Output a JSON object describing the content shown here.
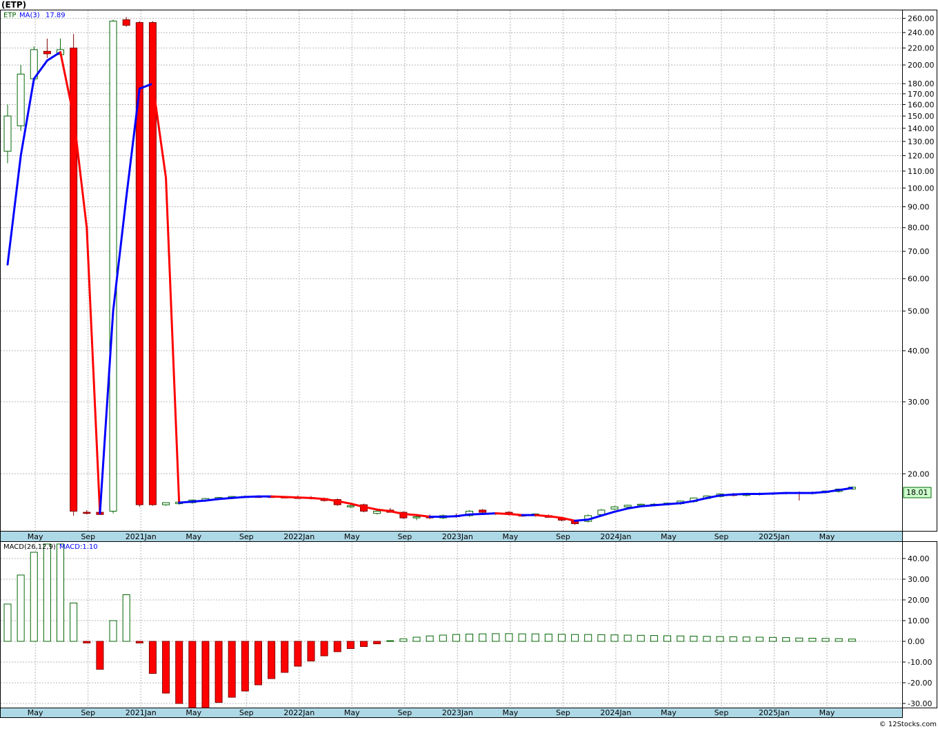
{
  "header": {
    "symbol_title": "(ETP)",
    "price_legend_symbol": "ETP",
    "price_legend_ma_label": "MA(3)",
    "price_legend_ma_value": "17.89",
    "macd_legend_label": "MACD(26,12,9)",
    "macd_legend_value": "MACD:1.10",
    "last_price_tag": "18.01",
    "credit": "© 12Stocks.com"
  },
  "colors": {
    "up_candle": "#006400",
    "down_candle": "#ff0000",
    "ma_up": "#0000ff",
    "ma_down": "#ff0000",
    "axis_strip": "#add8e6",
    "grid": "#b4b4b4",
    "last_price_bg": "#ccffcc"
  },
  "chart_data": [
    {
      "type": "candlestick",
      "scale": "log",
      "series_name": "ETP",
      "ma_name": "MA(3)",
      "y_ticks": [
        20,
        30,
        40,
        50,
        60,
        70,
        80,
        90,
        100,
        110,
        120,
        130,
        140,
        150,
        160,
        170,
        180,
        200,
        220,
        240,
        260
      ],
      "y_tick_labels": [
        "20.00",
        "30.00",
        "40.00",
        "50.00",
        "60.00",
        "70.00",
        "80.00",
        "90.00",
        "100.00",
        "110.00",
        "120.00",
        "130.00",
        "140.00",
        "150.00",
        "160.00",
        "170.00",
        "180.00",
        "200.00",
        "220.00",
        "240.00",
        "260.00"
      ],
      "ylim": [
        14.5,
        272
      ],
      "x_labels": [
        {
          "label": "May",
          "bar": 2.1
        },
        {
          "label": "Sep",
          "bar": 6.1
        },
        {
          "label": "2021Jan",
          "bar": 10.1
        },
        {
          "label": "May",
          "bar": 14.1
        },
        {
          "label": "Sep",
          "bar": 18.1
        },
        {
          "label": "2022Jan",
          "bar": 22.1
        },
        {
          "label": "May",
          "bar": 26.1
        },
        {
          "label": "Sep",
          "bar": 30.1
        },
        {
          "label": "2023Jan",
          "bar": 34.1
        },
        {
          "label": "May",
          "bar": 38.1
        },
        {
          "label": "Sep",
          "bar": 42.1
        },
        {
          "label": "2024Jan",
          "bar": 46.1
        },
        {
          "label": "May",
          "bar": 50.1
        },
        {
          "label": "Sep",
          "bar": 54.1
        },
        {
          "label": "2025Jan",
          "bar": 58.1
        },
        {
          "label": "May",
          "bar": 62.1
        }
      ],
      "candles": [
        {
          "o": 123,
          "h": 160,
          "l": 115,
          "c": 150
        },
        {
          "o": 142,
          "h": 200,
          "l": 138,
          "c": 190
        },
        {
          "o": 185,
          "h": 222,
          "l": 182,
          "c": 218
        },
        {
          "o": 216,
          "h": 232,
          "l": 208,
          "c": 213
        },
        {
          "o": 212,
          "h": 232,
          "l": 210,
          "c": 218
        },
        {
          "o": 220,
          "h": 238,
          "l": 15.8,
          "c": 16.2
        },
        {
          "o": 16.1,
          "h": 16.3,
          "l": 15.9,
          "c": 16.0
        },
        {
          "o": 16.1,
          "h": 16.2,
          "l": 15.9,
          "c": 15.9
        },
        {
          "o": 16.2,
          "h": 258,
          "l": 16.0,
          "c": 256
        },
        {
          "o": 258,
          "h": 262,
          "l": 248,
          "c": 250
        },
        {
          "o": 254,
          "h": 256,
          "l": 16.6,
          "c": 16.8
        },
        {
          "o": 254,
          "h": 256,
          "l": 16.7,
          "c": 16.8
        },
        {
          "o": 16.8,
          "h": 17.0,
          "l": 16.7,
          "c": 17.0
        },
        {
          "o": 16.9,
          "h": 17.1,
          "l": 16.8,
          "c": 17.05
        },
        {
          "o": 17.0,
          "h": 17.3,
          "l": 16.9,
          "c": 17.25
        },
        {
          "o": 17.2,
          "h": 17.45,
          "l": 17.1,
          "c": 17.4
        },
        {
          "o": 17.4,
          "h": 17.55,
          "l": 17.3,
          "c": 17.5
        },
        {
          "o": 17.5,
          "h": 17.65,
          "l": 17.4,
          "c": 17.6
        },
        {
          "o": 17.55,
          "h": 17.7,
          "l": 17.45,
          "c": 17.6
        },
        {
          "o": 17.6,
          "h": 17.7,
          "l": 17.5,
          "c": 17.55
        },
        {
          "o": 17.6,
          "h": 17.7,
          "l": 17.5,
          "c": 17.55
        },
        {
          "o": 17.55,
          "h": 17.65,
          "l": 17.45,
          "c": 17.5
        },
        {
          "o": 17.5,
          "h": 17.7,
          "l": 17.4,
          "c": 17.45
        },
        {
          "o": 17.5,
          "h": 17.65,
          "l": 17.3,
          "c": 17.4
        },
        {
          "o": 17.4,
          "h": 17.5,
          "l": 17.1,
          "c": 17.2
        },
        {
          "o": 17.3,
          "h": 17.4,
          "l": 16.7,
          "c": 16.8
        },
        {
          "o": 16.6,
          "h": 16.8,
          "l": 16.5,
          "c": 16.7
        },
        {
          "o": 16.8,
          "h": 16.9,
          "l": 16.1,
          "c": 16.2
        },
        {
          "o": 16.0,
          "h": 16.3,
          "l": 15.9,
          "c": 16.2
        },
        {
          "o": 16.3,
          "h": 16.5,
          "l": 16.1,
          "c": 16.1
        },
        {
          "o": 16.1,
          "h": 16.2,
          "l": 15.5,
          "c": 15.6
        },
        {
          "o": 15.6,
          "h": 15.8,
          "l": 15.4,
          "c": 15.7
        },
        {
          "o": 15.7,
          "h": 15.9,
          "l": 15.5,
          "c": 15.6
        },
        {
          "o": 15.6,
          "h": 15.9,
          "l": 15.5,
          "c": 15.8
        },
        {
          "o": 15.8,
          "h": 16.0,
          "l": 15.6,
          "c": 15.7
        },
        {
          "o": 15.8,
          "h": 16.3,
          "l": 15.7,
          "c": 16.2
        },
        {
          "o": 16.3,
          "h": 16.4,
          "l": 16.0,
          "c": 16.1
        },
        {
          "o": 16.0,
          "h": 16.1,
          "l": 15.85,
          "c": 16.05
        },
        {
          "o": 16.1,
          "h": 16.2,
          "l": 15.8,
          "c": 15.9
        },
        {
          "o": 15.85,
          "h": 15.95,
          "l": 15.7,
          "c": 15.8
        },
        {
          "o": 15.8,
          "h": 16.0,
          "l": 15.7,
          "c": 15.95
        },
        {
          "o": 15.8,
          "h": 15.9,
          "l": 15.6,
          "c": 15.65
        },
        {
          "o": 15.6,
          "h": 15.7,
          "l": 15.3,
          "c": 15.4
        },
        {
          "o": 15.3,
          "h": 15.4,
          "l": 15.0,
          "c": 15.1
        },
        {
          "o": 15.3,
          "h": 15.9,
          "l": 15.2,
          "c": 15.8
        },
        {
          "o": 15.9,
          "h": 16.4,
          "l": 15.8,
          "c": 16.3
        },
        {
          "o": 16.4,
          "h": 16.7,
          "l": 16.3,
          "c": 16.6
        },
        {
          "o": 16.6,
          "h": 16.8,
          "l": 16.5,
          "c": 16.75
        },
        {
          "o": 16.75,
          "h": 16.9,
          "l": 16.6,
          "c": 16.85
        },
        {
          "o": 16.8,
          "h": 16.95,
          "l": 16.7,
          "c": 16.85
        },
        {
          "o": 16.85,
          "h": 17.0,
          "l": 16.75,
          "c": 16.95
        },
        {
          "o": 16.9,
          "h": 17.2,
          "l": 16.8,
          "c": 17.15
        },
        {
          "o": 17.1,
          "h": 17.5,
          "l": 17.0,
          "c": 17.45
        },
        {
          "o": 17.4,
          "h": 17.7,
          "l": 17.3,
          "c": 17.65
        },
        {
          "o": 17.6,
          "h": 17.9,
          "l": 17.5,
          "c": 17.85
        },
        {
          "o": 17.8,
          "h": 17.95,
          "l": 17.6,
          "c": 17.7
        },
        {
          "o": 17.7,
          "h": 17.95,
          "l": 17.6,
          "c": 17.9
        },
        {
          "o": 17.8,
          "h": 18.0,
          "l": 17.7,
          "c": 17.9
        },
        {
          "o": 17.85,
          "h": 18.0,
          "l": 17.75,
          "c": 17.95
        },
        {
          "o": 17.9,
          "h": 18.05,
          "l": 17.8,
          "c": 18.0
        },
        {
          "o": 18.0,
          "h": 18.1,
          "l": 17.2,
          "c": 17.9
        },
        {
          "o": 17.9,
          "h": 18.1,
          "l": 17.8,
          "c": 18.0
        },
        {
          "o": 18.0,
          "h": 18.2,
          "l": 17.9,
          "c": 18.15
        },
        {
          "o": 18.1,
          "h": 18.4,
          "l": 18.0,
          "c": 18.35
        },
        {
          "o": 18.35,
          "h": 18.6,
          "l": 18.3,
          "c": 18.55
        }
      ],
      "ma_values": [
        65,
        120,
        185,
        205,
        215,
        150,
        80,
        16.0,
        50,
        95,
        175,
        180,
        106,
        17.0,
        17.1,
        17.2,
        17.35,
        17.45,
        17.55,
        17.6,
        17.6,
        17.55,
        17.5,
        17.45,
        17.35,
        17.15,
        16.9,
        16.6,
        16.35,
        16.2,
        15.95,
        15.85,
        15.7,
        15.7,
        15.75,
        15.9,
        15.95,
        16.0,
        15.95,
        15.85,
        15.85,
        15.75,
        15.6,
        15.35,
        15.45,
        15.8,
        16.15,
        16.45,
        16.65,
        16.75,
        16.85,
        16.95,
        17.15,
        17.45,
        17.7,
        17.8,
        17.85,
        17.85,
        17.9,
        17.95,
        17.95,
        17.95,
        18.05,
        18.25,
        18.45
      ],
      "last_price": 18.01
    },
    {
      "type": "bar",
      "series_name": "MACD(26,12,9)",
      "y_ticks": [
        -30,
        -20,
        -10,
        0,
        10,
        20,
        30,
        40
      ],
      "y_tick_labels": [
        "-30.00",
        "-20.00",
        "-10.00",
        "0.00",
        "10.00",
        "20.00",
        "30.00",
        "40.00"
      ],
      "ylim": [
        -32,
        48
      ],
      "x_labels": [
        {
          "label": "May",
          "bar": 2.1
        },
        {
          "label": "Sep",
          "bar": 6.1
        },
        {
          "label": "2021Jan",
          "bar": 10.1
        },
        {
          "label": "May",
          "bar": 14.1
        },
        {
          "label": "Sep",
          "bar": 18.1
        },
        {
          "label": "2022Jan",
          "bar": 22.1
        },
        {
          "label": "May",
          "bar": 26.1
        },
        {
          "label": "Sep",
          "bar": 30.1
        },
        {
          "label": "2023Jan",
          "bar": 34.1
        },
        {
          "label": "May",
          "bar": 38.1
        },
        {
          "label": "Sep",
          "bar": 42.1
        },
        {
          "label": "2024Jan",
          "bar": 46.1
        },
        {
          "label": "May",
          "bar": 50.1
        },
        {
          "label": "Sep",
          "bar": 54.1
        },
        {
          "label": "2025Jan",
          "bar": 58.1
        },
        {
          "label": "May",
          "bar": 62.1
        }
      ],
      "values": [
        18,
        32,
        43,
        47,
        47,
        18.5,
        -0.8,
        -13.5,
        10,
        22.5,
        -0.8,
        -15.5,
        -25,
        -30,
        -32,
        -32,
        -29.5,
        -27,
        -24,
        -21,
        -18,
        -15,
        -12,
        -9.5,
        -7,
        -5,
        -3.5,
        -2.5,
        -1.2,
        0.3,
        1.2,
        2.0,
        2.6,
        3.0,
        3.3,
        3.5,
        3.6,
        3.7,
        3.7,
        3.6,
        3.6,
        3.5,
        3.4,
        3.3,
        3.3,
        3.2,
        3.1,
        3.0,
        2.9,
        2.8,
        2.7,
        2.6,
        2.5,
        2.4,
        2.3,
        2.2,
        2.1,
        2.0,
        1.9,
        1.8,
        1.6,
        1.5,
        1.4,
        1.3,
        1.1
      ],
      "last_value": 1.1
    }
  ]
}
